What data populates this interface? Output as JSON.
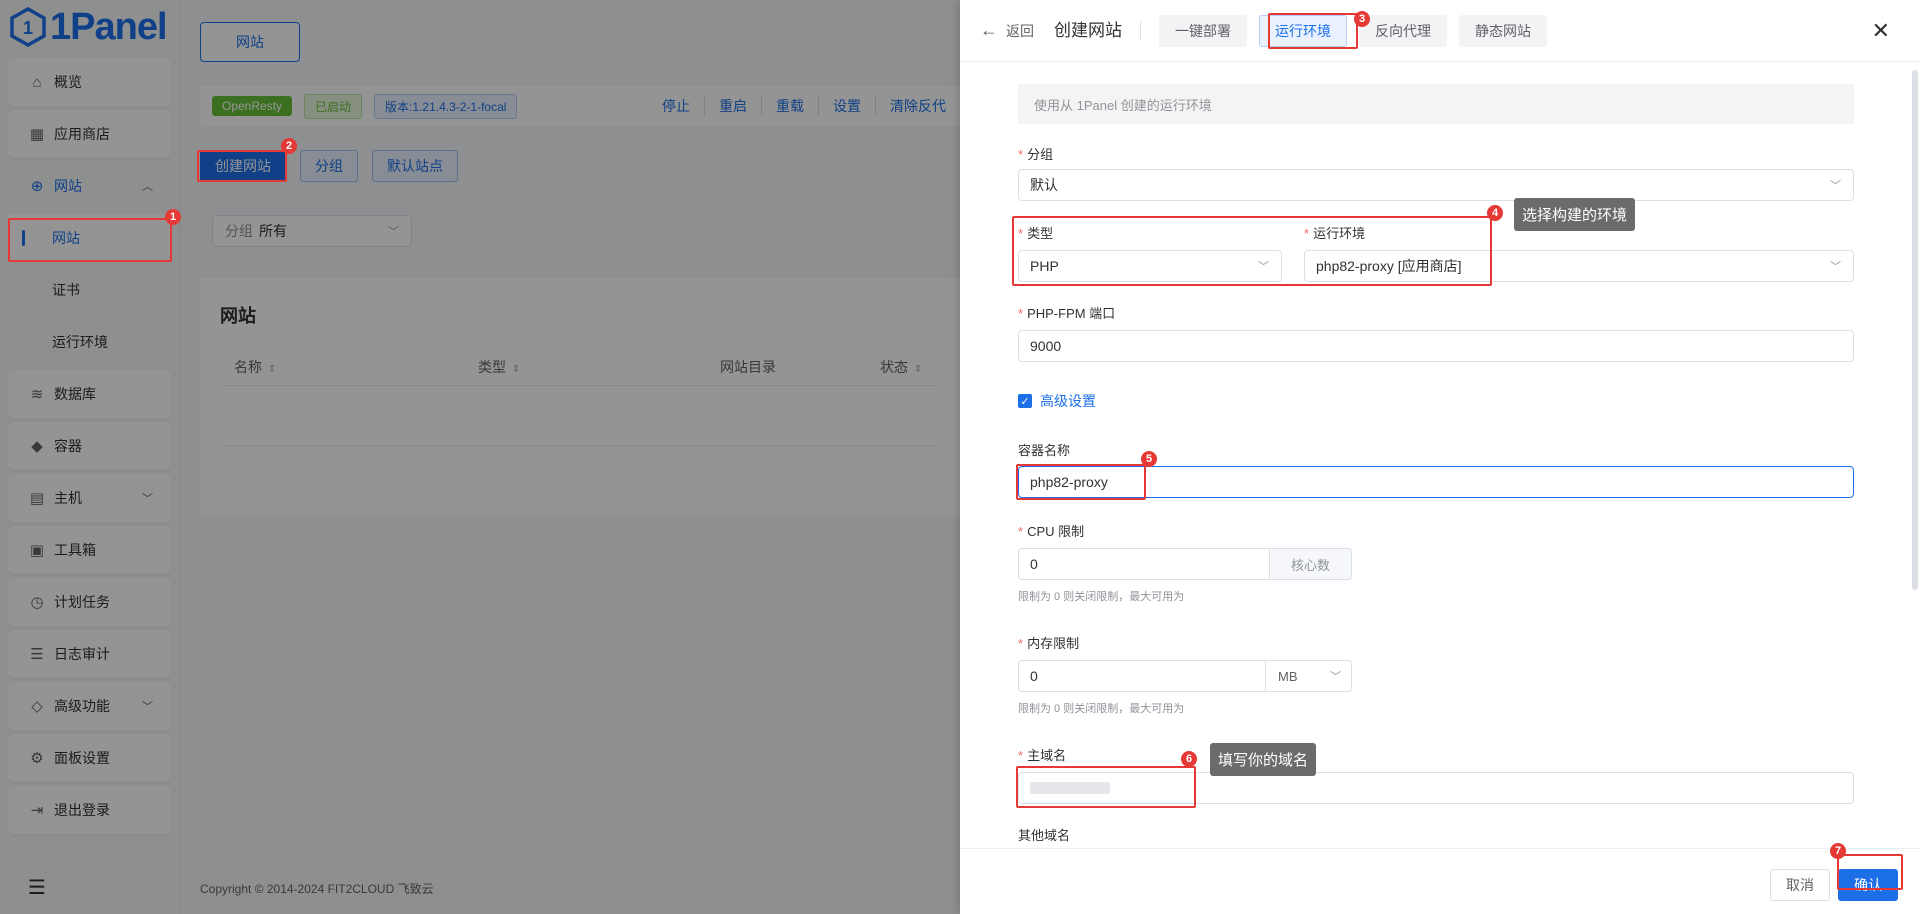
{
  "app": {
    "logo_text": "1Panel",
    "logo_icon": "1panel-logo-icon",
    "brand_color": "#1d6fe8"
  },
  "sidebar": {
    "items": [
      {
        "label": "概览",
        "icon": "home-icon"
      },
      {
        "label": "应用商店",
        "icon": "grid-icon"
      },
      {
        "label": "网站",
        "icon": "globe-icon",
        "expanded": true
      },
      {
        "label": "网站",
        "sub": true,
        "active": true
      },
      {
        "label": "证书",
        "sub": true
      },
      {
        "label": "运行环境",
        "sub": true
      },
      {
        "label": "数据库",
        "icon": "layers-icon"
      },
      {
        "label": "容器",
        "icon": "docker-icon"
      },
      {
        "label": "主机",
        "icon": "server-icon",
        "has_children": true
      },
      {
        "label": "工具箱",
        "icon": "toolbox-icon"
      },
      {
        "label": "计划任务",
        "icon": "calendar-icon"
      },
      {
        "label": "日志审计",
        "icon": "log-icon"
      },
      {
        "label": "高级功能",
        "icon": "diamond-icon",
        "has_children": true
      },
      {
        "label": "面板设置",
        "icon": "gear-icon"
      },
      {
        "label": "退出登录",
        "icon": "logout-icon"
      }
    ],
    "footer_icon": "menu-fold-icon"
  },
  "main": {
    "tab": "网站",
    "status": {
      "server": "OpenResty",
      "state": "已启动",
      "version": "版本:1.21.4.3-2-1-focal"
    },
    "toolbar_links": [
      "停止",
      "重启",
      "重载",
      "设置",
      "清除反代"
    ],
    "buttons": {
      "create": "创建网站",
      "group": "分组",
      "default_site": "默认站点"
    },
    "filter": {
      "label": "分组",
      "value": "所有"
    },
    "card_title": "网站",
    "table_headers": [
      "名称",
      "类型",
      "网站目录",
      "状态"
    ],
    "footer": "Copyright © 2014-2024 FIT2CLOUD 飞致云"
  },
  "drawer": {
    "back": "返回",
    "title": "创建网站",
    "tabs": [
      "一键部署",
      "运行环境",
      "反向代理",
      "静态网站"
    ],
    "active_tab": "运行环境",
    "info": "使用从 1Panel 创建的运行环境",
    "fields": {
      "group_label": "分组",
      "group_value": "默认",
      "type_label": "类型",
      "type_value": "PHP",
      "runtime_label": "运行环境",
      "runtime_value": "php82-proxy [应用商店]",
      "fpm_label": "PHP-FPM 端口",
      "fpm_value": "9000",
      "advanced_label": "高级设置",
      "container_label": "容器名称",
      "container_value": "php82-proxy",
      "cpu_label": "CPU 限制",
      "cpu_value": "0",
      "cpu_unit": "核心数",
      "cpu_hint": "限制为 0 则关闭限制，最大可用为",
      "mem_label": "内存限制",
      "mem_value": "0",
      "mem_unit": "MB",
      "mem_hint": "限制为 0 则关闭限制，最大可用为",
      "domain_label": "主域名",
      "other_domain_label": "其他域名"
    },
    "footer": {
      "cancel": "取消",
      "confirm": "确认"
    }
  },
  "annotations": {
    "badges": [
      "1",
      "2",
      "3",
      "4",
      "5",
      "6",
      "7"
    ],
    "tip_env": "选择构建的环境",
    "tip_domain": "填写你的域名",
    "color": "#e53935"
  }
}
